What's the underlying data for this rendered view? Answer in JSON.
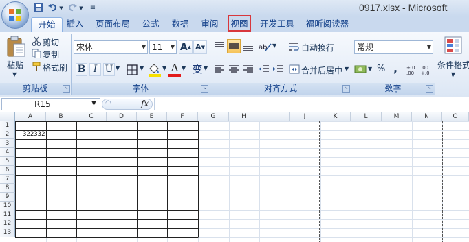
{
  "window": {
    "title": "0917.xlsx - Microsoft"
  },
  "quick_access": {
    "save_icon": "save-icon",
    "undo_icon": "undo-icon",
    "redo_icon": "redo-icon",
    "customize_icon": "customize-icon"
  },
  "tabs": [
    {
      "label": "开始",
      "active": true
    },
    {
      "label": "插入"
    },
    {
      "label": "页面布局"
    },
    {
      "label": "公式"
    },
    {
      "label": "数据"
    },
    {
      "label": "审阅"
    },
    {
      "label": "视图",
      "highlighted": true
    },
    {
      "label": "开发工具"
    },
    {
      "label": "福昕阅读器"
    }
  ],
  "ribbon": {
    "clipboard": {
      "paste_label": "粘贴",
      "cut_label": "剪切",
      "copy_label": "复制",
      "format_painter_label": "格式刷",
      "group_label": "剪贴板"
    },
    "font": {
      "font_name": "宋体",
      "font_size": "11",
      "bold": "B",
      "italic": "I",
      "underline": "U",
      "font_color_glyph": "A",
      "grow_glyph": "A",
      "shrink_glyph": "A",
      "phonetic_glyph": "变",
      "group_label": "字体"
    },
    "alignment": {
      "wrap_label": "自动换行",
      "merge_label": "合并后居中",
      "group_label": "对齐方式"
    },
    "number": {
      "format": "常规",
      "percent": "%",
      "comma": ",",
      "inc_decimal": "+.0\n.00",
      "dec_decimal": ".00\n+.0",
      "group_label": "数字"
    },
    "styles": {
      "conditional_label": "条件格式"
    }
  },
  "formula_bar": {
    "name_box": "R15",
    "fx_label": "fx",
    "formula": ""
  },
  "grid": {
    "columns": [
      "A",
      "B",
      "C",
      "D",
      "E",
      "F",
      "G",
      "H",
      "I",
      "J",
      "K",
      "L",
      "M",
      "N",
      "O"
    ],
    "rows": [
      "1",
      "2",
      "3",
      "4",
      "5",
      "6",
      "7",
      "8",
      "9",
      "10",
      "11",
      "12",
      "13"
    ],
    "cells": {
      "A2": "322332"
    }
  },
  "colors": {
    "accent": "#15428b",
    "highlight_border": "#d8373c",
    "ribbon_bg": "#dbe6f4"
  }
}
